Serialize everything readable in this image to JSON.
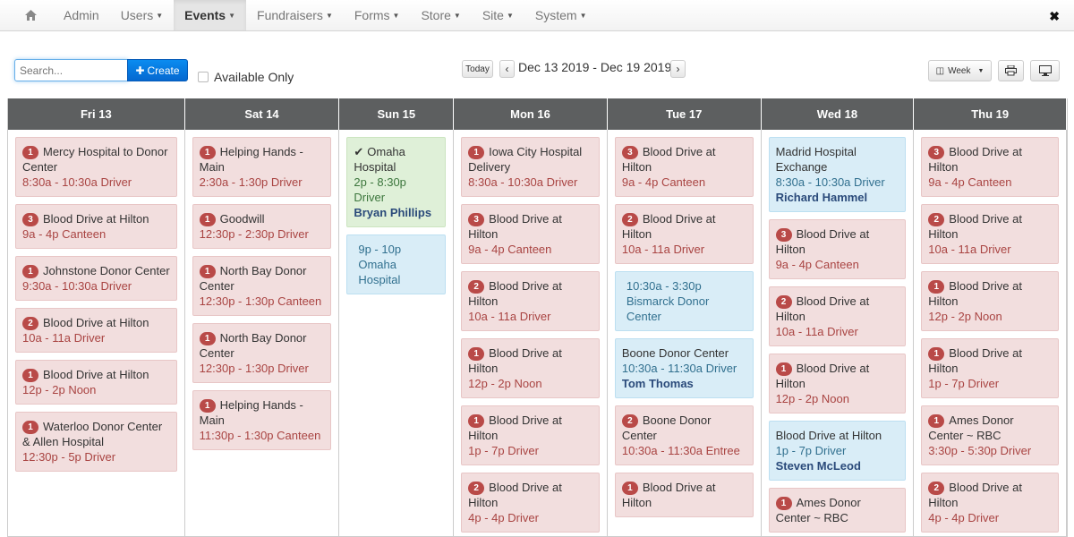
{
  "nav": {
    "items": [
      {
        "label": "Admin",
        "caret": false,
        "active": false
      },
      {
        "label": "Users",
        "caret": true,
        "active": false
      },
      {
        "label": "Events",
        "caret": true,
        "active": true
      },
      {
        "label": "Fundraisers",
        "caret": true,
        "active": false
      },
      {
        "label": "Forms",
        "caret": true,
        "active": false
      },
      {
        "label": "Store",
        "caret": true,
        "active": false
      },
      {
        "label": "Site",
        "caret": true,
        "active": false
      },
      {
        "label": "System",
        "caret": true,
        "active": false
      }
    ],
    "home_icon": "home-icon",
    "close_icon": "close-icon"
  },
  "toolbar": {
    "search_placeholder": "Search...",
    "create_label": "Create",
    "available_only_label": "Available Only",
    "today_label": "Today",
    "date_range": "Dec 13 2019 - Dec 19 2019",
    "view_label": "Week"
  },
  "calendar": {
    "days": [
      "Fri 13",
      "Sat 14",
      "Sun 15",
      "Mon 16",
      "Tue 17",
      "Wed 18",
      "Thu 19"
    ],
    "columns": [
      [
        {
          "color": "red",
          "badge": "1",
          "title": "Mercy Hospital to Donor Center",
          "time": "8:30a - 10:30a Driver"
        },
        {
          "color": "red",
          "badge": "3",
          "title": "Blood Drive at Hilton",
          "time": "9a - 4p Canteen"
        },
        {
          "color": "red",
          "badge": "1",
          "title": "Johnstone Donor Center",
          "time": "9:30a - 10:30a Driver"
        },
        {
          "color": "red",
          "badge": "2",
          "title": "Blood Drive at Hilton",
          "time": "10a - 11a Driver"
        },
        {
          "color": "red",
          "badge": "1",
          "title": "Blood Drive at Hilton",
          "time": "12p - 2p Noon"
        },
        {
          "color": "red",
          "badge": "1",
          "title": "Waterloo Donor Center & Allen Hospital",
          "time": "12:30p - 5p Driver"
        }
      ],
      [
        {
          "color": "red",
          "badge": "1",
          "title": "Helping Hands - Main",
          "time": "2:30a - 1:30p Driver"
        },
        {
          "color": "red",
          "badge": "1",
          "title": "Goodwill",
          "time": "12:30p - 2:30p Driver"
        },
        {
          "color": "red",
          "badge": "1",
          "title": "North Bay Donor Center",
          "time": "12:30p - 1:30p Canteen"
        },
        {
          "color": "red",
          "badge": "1",
          "title": "North Bay Donor Center",
          "time": "12:30p - 1:30p Driver"
        },
        {
          "color": "red",
          "badge": "1",
          "title": "Helping Hands - Main",
          "time": "11:30p - 1:30p Canteen"
        }
      ],
      [
        {
          "color": "green",
          "check": true,
          "title": "Omaha Hospital",
          "time": "2p - 8:30p Driver",
          "person": "Bryan Phillips"
        },
        {
          "color": "blue",
          "title": "",
          "time": "9p - 10p Omaha Hospital"
        }
      ],
      [
        {
          "color": "red",
          "badge": "1",
          "title": "Iowa City Hospital Delivery",
          "time": "8:30a - 10:30a Driver"
        },
        {
          "color": "red",
          "badge": "3",
          "title": "Blood Drive at Hilton",
          "time": "9a - 4p Canteen"
        },
        {
          "color": "red",
          "badge": "2",
          "title": "Blood Drive at Hilton",
          "time": "10a - 11a Driver"
        },
        {
          "color": "red",
          "badge": "1",
          "title": "Blood Drive at Hilton",
          "time": "12p - 2p Noon"
        },
        {
          "color": "red",
          "badge": "1",
          "title": "Blood Drive at Hilton",
          "time": "1p - 7p Driver"
        },
        {
          "color": "red",
          "badge": "2",
          "title": "Blood Drive at Hilton",
          "time": "4p - 4p Driver"
        }
      ],
      [
        {
          "color": "red",
          "badge": "3",
          "title": "Blood Drive at Hilton",
          "time": "9a - 4p Canteen"
        },
        {
          "color": "red",
          "badge": "2",
          "title": "Blood Drive at Hilton",
          "time": "10a - 11a Driver"
        },
        {
          "color": "blue",
          "title": "",
          "time": "10:30a - 3:30p Bismarck Donor Center"
        },
        {
          "color": "blue",
          "title": "Boone Donor Center",
          "time": "10:30a - 11:30a Driver",
          "person": "Tom Thomas"
        },
        {
          "color": "red",
          "badge": "2",
          "title": "Boone Donor Center",
          "time": "10:30a - 11:30a Entree"
        },
        {
          "color": "red",
          "badge": "1",
          "title": "Blood Drive at Hilton",
          "time": ""
        }
      ],
      [
        {
          "color": "blue",
          "title": "Madrid Hospital Exchange",
          "time": "8:30a - 10:30a Driver",
          "person": "Richard Hammel"
        },
        {
          "color": "red",
          "badge": "3",
          "title": "Blood Drive at Hilton",
          "time": "9a - 4p Canteen"
        },
        {
          "color": "red",
          "badge": "2",
          "title": "Blood Drive at Hilton",
          "time": "10a - 11a Driver"
        },
        {
          "color": "red",
          "badge": "1",
          "title": "Blood Drive at Hilton",
          "time": "12p - 2p Noon"
        },
        {
          "color": "blue",
          "title": "Blood Drive at Hilton",
          "time": "1p - 7p Driver",
          "person": "Steven McLeod"
        },
        {
          "color": "red",
          "badge": "1",
          "title": "Ames Donor Center ~ RBC",
          "time": ""
        }
      ],
      [
        {
          "color": "red",
          "badge": "3",
          "title": "Blood Drive at Hilton",
          "time": "9a - 4p Canteen"
        },
        {
          "color": "red",
          "badge": "2",
          "title": "Blood Drive at Hilton",
          "time": "10a - 11a Driver"
        },
        {
          "color": "red",
          "badge": "1",
          "title": "Blood Drive at Hilton",
          "time": "12p - 2p Noon"
        },
        {
          "color": "red",
          "badge": "1",
          "title": "Blood Drive at Hilton",
          "time": "1p - 7p Driver"
        },
        {
          "color": "red",
          "badge": "1",
          "title": "Ames Donor Center ~ RBC",
          "time": "3:30p - 5:30p Driver"
        },
        {
          "color": "red",
          "badge": "2",
          "title": "Blood Drive at Hilton",
          "time": "4p - 4p Driver"
        }
      ]
    ]
  }
}
